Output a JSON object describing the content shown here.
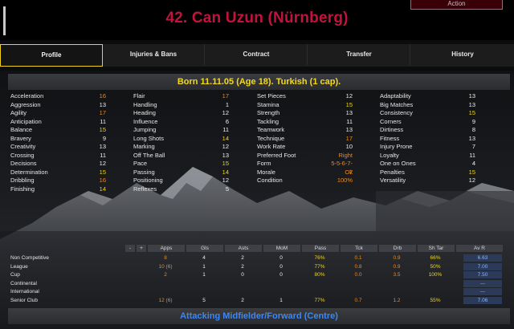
{
  "header": {
    "title": "42. Can Uzun (Nürnberg)",
    "action_label": "Action"
  },
  "tabs": [
    {
      "label": "Profile",
      "active": true
    },
    {
      "label": "Injuries & Bans",
      "active": false
    },
    {
      "label": "Contract",
      "active": false
    },
    {
      "label": "Transfer",
      "active": false
    },
    {
      "label": "History",
      "active": false
    }
  ],
  "born_line": "Born 11.11.05 (Age 18). Turkish (1 cap).",
  "attributes": {
    "col1": [
      {
        "label": "Acceleration",
        "value": "16",
        "tone": "orange"
      },
      {
        "label": "Aggression",
        "value": "13",
        "tone": "white"
      },
      {
        "label": "Agility",
        "value": "17",
        "tone": "orange"
      },
      {
        "label": "Anticipation",
        "value": "11",
        "tone": "white"
      },
      {
        "label": "Balance",
        "value": "15",
        "tone": "yellow"
      },
      {
        "label": "Bravery",
        "value": "9",
        "tone": "white"
      },
      {
        "label": "Creativity",
        "value": "13",
        "tone": "white"
      },
      {
        "label": "Crossing",
        "value": "11",
        "tone": "white"
      },
      {
        "label": "Decisions",
        "value": "12",
        "tone": "white"
      },
      {
        "label": "Determination",
        "value": "15",
        "tone": "yellow"
      },
      {
        "label": "Dribbling",
        "value": "16",
        "tone": "orange"
      },
      {
        "label": "Finishing",
        "value": "14",
        "tone": "yellow"
      }
    ],
    "col2": [
      {
        "label": "Flair",
        "value": "17",
        "tone": "orange"
      },
      {
        "label": "Handling",
        "value": "1",
        "tone": "white"
      },
      {
        "label": "Heading",
        "value": "12",
        "tone": "white"
      },
      {
        "label": "Influence",
        "value": "6",
        "tone": "white"
      },
      {
        "label": "Jumping",
        "value": "11",
        "tone": "white"
      },
      {
        "label": "Long Shots",
        "value": "14",
        "tone": "yellow"
      },
      {
        "label": "Marking",
        "value": "12",
        "tone": "white"
      },
      {
        "label": "Off The Ball",
        "value": "13",
        "tone": "white"
      },
      {
        "label": "Pace",
        "value": "15",
        "tone": "yellow"
      },
      {
        "label": "Passing",
        "value": "14",
        "tone": "yellow"
      },
      {
        "label": "Positioning",
        "value": "12",
        "tone": "white"
      },
      {
        "label": "Reflexes",
        "value": "5",
        "tone": "white"
      }
    ],
    "col3": [
      {
        "label": "Set Pieces",
        "value": "12",
        "tone": "white"
      },
      {
        "label": "Stamina",
        "value": "15",
        "tone": "yellow"
      },
      {
        "label": "Strength",
        "value": "13",
        "tone": "white"
      },
      {
        "label": "Tackling",
        "value": "11",
        "tone": "white"
      },
      {
        "label": "Teamwork",
        "value": "13",
        "tone": "white"
      },
      {
        "label": "Technique",
        "value": "17",
        "tone": "orange"
      },
      {
        "label": "Work Rate",
        "value": "10",
        "tone": "white"
      },
      {
        "label": "Preferred Foot",
        "value": "Right",
        "tone": "orange"
      },
      {
        "label": "Form",
        "value": "5-5-6-7-7",
        "tone": "orange"
      },
      {
        "label": "Morale",
        "value": "Ok",
        "tone": "orange"
      },
      {
        "label": "Condition",
        "value": "100%",
        "tone": "orange"
      }
    ],
    "col4": [
      {
        "label": "Adaptability",
        "value": "13",
        "tone": "white"
      },
      {
        "label": "Big Matches",
        "value": "13",
        "tone": "white"
      },
      {
        "label": "Consistency",
        "value": "15",
        "tone": "yellow"
      },
      {
        "label": "Corners",
        "value": "9",
        "tone": "white"
      },
      {
        "label": "Dirtiness",
        "value": "8",
        "tone": "white"
      },
      {
        "label": "Fitness",
        "value": "13",
        "tone": "white"
      },
      {
        "label": "Injury Prone",
        "value": "7",
        "tone": "white"
      },
      {
        "label": "Loyalty",
        "value": "11",
        "tone": "white"
      },
      {
        "label": "One on Ones",
        "value": "4",
        "tone": "white"
      },
      {
        "label": "Penalties",
        "value": "15",
        "tone": "yellow"
      },
      {
        "label": "Versatility",
        "value": "12",
        "tone": "white"
      }
    ]
  },
  "stats": {
    "headers": [
      "-",
      "+",
      "Apps",
      "Gls",
      "Asts",
      "MoM",
      "Pass",
      "Tck",
      "Drb",
      "Sh Tar",
      "Av R"
    ],
    "rows": [
      {
        "label": "Non Competitive",
        "cells": [
          "8",
          "4",
          "2",
          "0",
          "76%",
          "0.1",
          "0.9",
          "66%",
          "6.63"
        ]
      },
      {
        "label": "League",
        "cells": [
          "10 (6)",
          "1",
          "2",
          "0",
          "77%",
          "0.8",
          "0.9",
          "50%",
          "7.00"
        ]
      },
      {
        "label": "Cup",
        "cells": [
          "2",
          "1",
          "0",
          "0",
          "80%",
          "0.0",
          "3.5",
          "100%",
          "7.50"
        ]
      },
      {
        "label": "Continental",
        "cells": [
          "",
          "",
          "",
          "",
          "",
          "",
          "",
          "",
          "---"
        ]
      },
      {
        "label": "International",
        "cells": [
          "",
          "",
          "",
          "",
          "",
          "",
          "",
          "",
          "---"
        ]
      },
      {
        "label": "Senior Club",
        "cells": [
          "12 (6)",
          "5",
          "2",
          "1",
          "77%",
          "0.7",
          "1.2",
          "55%",
          "7.06"
        ]
      }
    ]
  },
  "role_line": "Attacking Midfielder/Forward (Centre)",
  "colors": {
    "title": "#c0143c",
    "accent_tab_border": "#f0d21c",
    "born": "#f3d820",
    "role": "#3d88f0"
  }
}
